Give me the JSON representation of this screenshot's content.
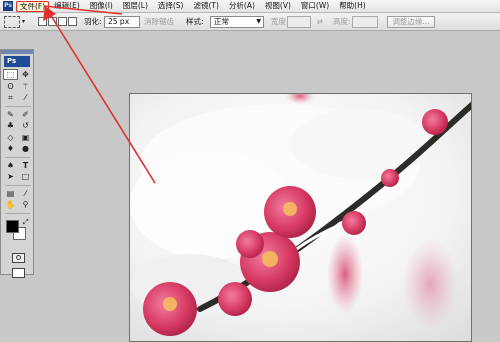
{
  "app": {
    "mini_logo": "Ps",
    "toolbox_logo": "Ps"
  },
  "menu": {
    "items": [
      {
        "label": "文件(F)",
        "highlighted": true
      },
      {
        "label": "编辑(E)"
      },
      {
        "label": "图像(I)"
      },
      {
        "label": "图层(L)"
      },
      {
        "label": "选择(S)"
      },
      {
        "label": "滤镜(T)"
      },
      {
        "label": "分析(A)"
      },
      {
        "label": "视图(V)"
      },
      {
        "label": "窗口(W)"
      },
      {
        "label": "帮助(H)"
      }
    ]
  },
  "options": {
    "feather_label": "羽化:",
    "feather_value": "25 px",
    "antialias_label": "消除锯齿",
    "style_label": "样式:",
    "style_value": "正常",
    "width_label": "宽度:",
    "height_label": "高度:",
    "refine_edge_label": "调整边缘..."
  },
  "colors": {
    "annotation_arrow": "#e03030",
    "foreground": "#000000",
    "background": "#ffffff"
  },
  "tools": [
    [
      "rect-marquee-icon",
      "move-icon"
    ],
    [
      "lasso-icon",
      "magic-wand-icon"
    ],
    [
      "crop-icon",
      "eyedropper-icon"
    ],
    [
      "healing-brush-icon",
      "brush-icon"
    ],
    [
      "clone-stamp-icon",
      "history-brush-icon"
    ],
    [
      "eraser-icon",
      "gradient-icon"
    ],
    [
      "blur-icon",
      "dodge-icon"
    ],
    [
      "pen-icon",
      "type-icon"
    ],
    [
      "path-select-icon",
      "shape-icon"
    ],
    [
      "notes-icon",
      "eyedropper-icon"
    ],
    [
      "hand-icon",
      "zoom-icon"
    ]
  ]
}
